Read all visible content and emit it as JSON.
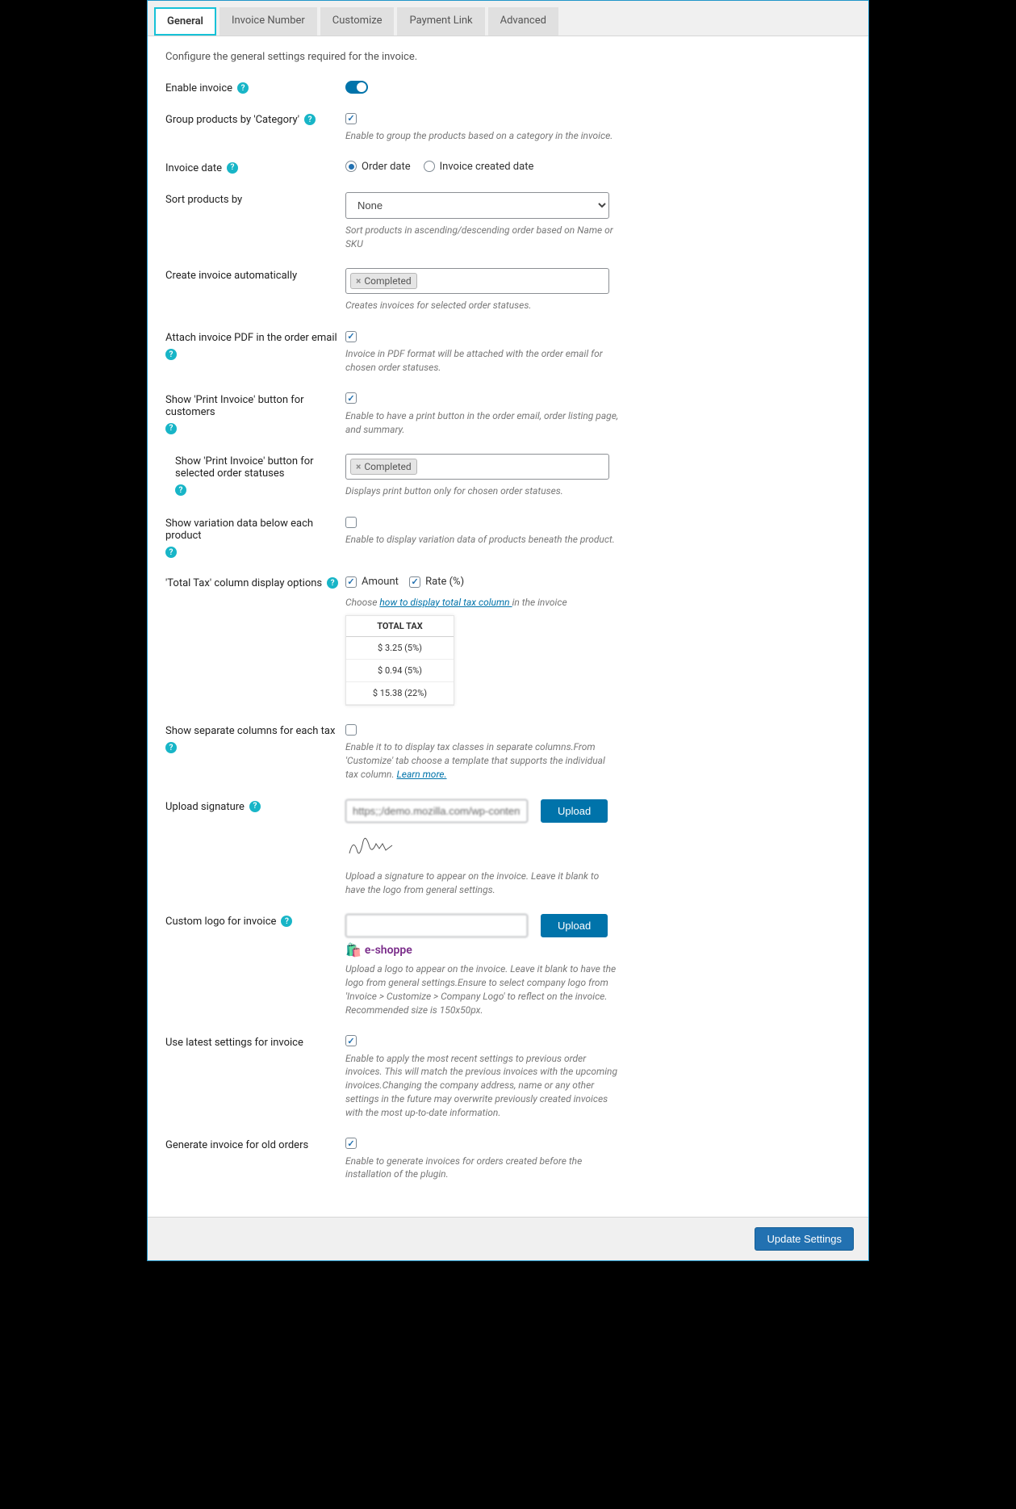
{
  "tabs": {
    "general": "General",
    "invoice_number": "Invoice Number",
    "customize": "Customize",
    "payment_link": "Payment Link",
    "advanced": "Advanced"
  },
  "intro": "Configure the general settings required for the invoice.",
  "labels": {
    "enable_invoice": "Enable invoice",
    "group_products": "Group products by 'Category'",
    "invoice_date": "Invoice date",
    "sort_products": "Sort products by",
    "create_auto": "Create invoice automatically",
    "attach_pdf": "Attach invoice PDF in the order email",
    "show_print": "Show 'Print Invoice' button for customers",
    "show_print_selected": "Show 'Print Invoice' button for selected order statuses",
    "show_variation": "Show variation data below each product",
    "total_tax": "'Total Tax' column display options",
    "separate_cols": "Show separate columns for each tax",
    "upload_signature": "Upload signature",
    "custom_logo": "Custom logo for invoice",
    "latest_settings": "Use latest settings for invoice",
    "generate_old": "Generate invoice for old orders"
  },
  "helpers": {
    "group_products": "Enable to group the products based on a category in the invoice.",
    "sort_products": "Sort products in ascending/descending order based on Name or SKU",
    "create_auto": "Creates invoices for selected order statuses.",
    "attach_pdf": "Invoice in PDF format will be attached with the order email for chosen order statuses.",
    "show_print": "Enable to have a print button in the order email, order listing page, and summary.",
    "show_print_selected": "Displays print button only for chosen order statuses.",
    "show_variation": "Enable to display variation data of products beneath the product.",
    "total_tax_pre": "Choose ",
    "total_tax_link": "how to display total tax column ",
    "total_tax_post": "in the invoice",
    "separate_cols_pre": "Enable it to to display tax classes in separate columns.From 'Customize' tab choose a template that supports the individual tax column. ",
    "separate_cols_link": "Learn more.",
    "upload_signature": "Upload a signature to appear on the invoice. Leave it blank to have the logo from general settings.",
    "custom_logo": "Upload a logo to appear on the invoice. Leave it blank to have the logo from general settings.Ensure to select company logo from 'Invoice > Customize > Company Logo' to reflect on the invoice. Recommended size is 150x50px.",
    "latest_settings": "Enable to apply the most recent settings to previous order invoices. This will match the previous invoices with the upcoming invoices.Changing the company address, name or any other settings in the future may overwrite previously created invoices with the most up-to-date information.",
    "generate_old": "Enable to generate invoices for orders created before the installation of the plugin."
  },
  "radio": {
    "order_date": "Order date",
    "invoice_created": "Invoice created date"
  },
  "sort_selected": "None",
  "tag_completed": "Completed",
  "tax_options": {
    "amount": "Amount",
    "rate": "Rate (%)"
  },
  "tax_table": {
    "header": "TOTAL TAX",
    "r1": "$ 3.25 (5%)",
    "r2": "$ 0.94 (5%)",
    "r3": "$ 15.38 (22%)"
  },
  "upload_button": "Upload",
  "signature_url": "https;;/demo.mozilla.com/wp-content/u",
  "logo_url": " ",
  "logo_name": "e-shoppe",
  "save_button": "Update Settings"
}
